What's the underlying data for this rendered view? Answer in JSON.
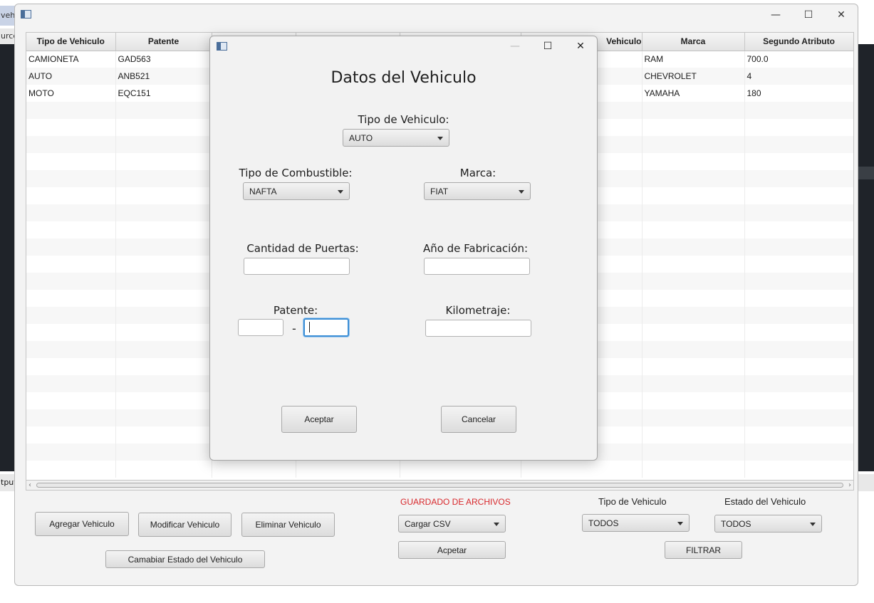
{
  "background": {
    "tab_text": "veh",
    "tab2_text": "urce",
    "output_text": "tput"
  },
  "main_window": {
    "controls": {
      "minimize": "—",
      "maximize": "☐",
      "close": "✕"
    },
    "table": {
      "columns": [
        "Tipo de Vehiculo",
        "Patente",
        "",
        "",
        "",
        "Vehiculo",
        "Marca",
        "Segundo Atributo"
      ],
      "rows": [
        [
          "CAMIONETA",
          "GAD563",
          "",
          "",
          "",
          "",
          "RAM",
          "700.0"
        ],
        [
          "AUTO",
          "ANB521",
          "",
          "",
          "",
          "",
          "CHEVROLET",
          "4"
        ],
        [
          "MOTO",
          "EQC151",
          "",
          "",
          "",
          "",
          "YAMAHA",
          "180"
        ]
      ],
      "empty_rows": 22
    },
    "bottom": {
      "agregar": "Agregar Vehiculo",
      "modificar": "Modificar Vehiculo",
      "eliminar": "Eliminar Vehiculo",
      "cambiar_estado": "Camabiar Estado del Vehiculo",
      "guardado_label": "GUARDADO DE ARCHIVOS",
      "guardado_combo": "Cargar CSV",
      "guardado_btn": "Acpetar",
      "tipo_label": "Tipo de Vehiculo",
      "tipo_combo": "TODOS",
      "estado_label": "Estado del Vehiculo",
      "estado_combo": "TODOS",
      "filtrar": "FILTRAR"
    }
  },
  "dialog": {
    "controls": {
      "minimize": "—",
      "maximize": "☐",
      "close": "✕"
    },
    "title": "Datos del Vehiculo",
    "tipo_label": "Tipo de Vehiculo:",
    "tipo_value": "AUTO",
    "combustible_label": "Tipo de Combustible:",
    "combustible_value": "NAFTA",
    "marca_label": "Marca:",
    "marca_value": "FIAT",
    "puertas_label": "Cantidad de Puertas:",
    "anio_label": "Año de Fabricación:",
    "patente_label": "Patente:",
    "patente_dash": "-",
    "kilometraje_label": "Kilometraje:",
    "aceptar": "Aceptar",
    "cancelar": "Cancelar"
  },
  "colors": {
    "accent_focus": "#3d8fd6",
    "red_label": "#d8282c"
  }
}
